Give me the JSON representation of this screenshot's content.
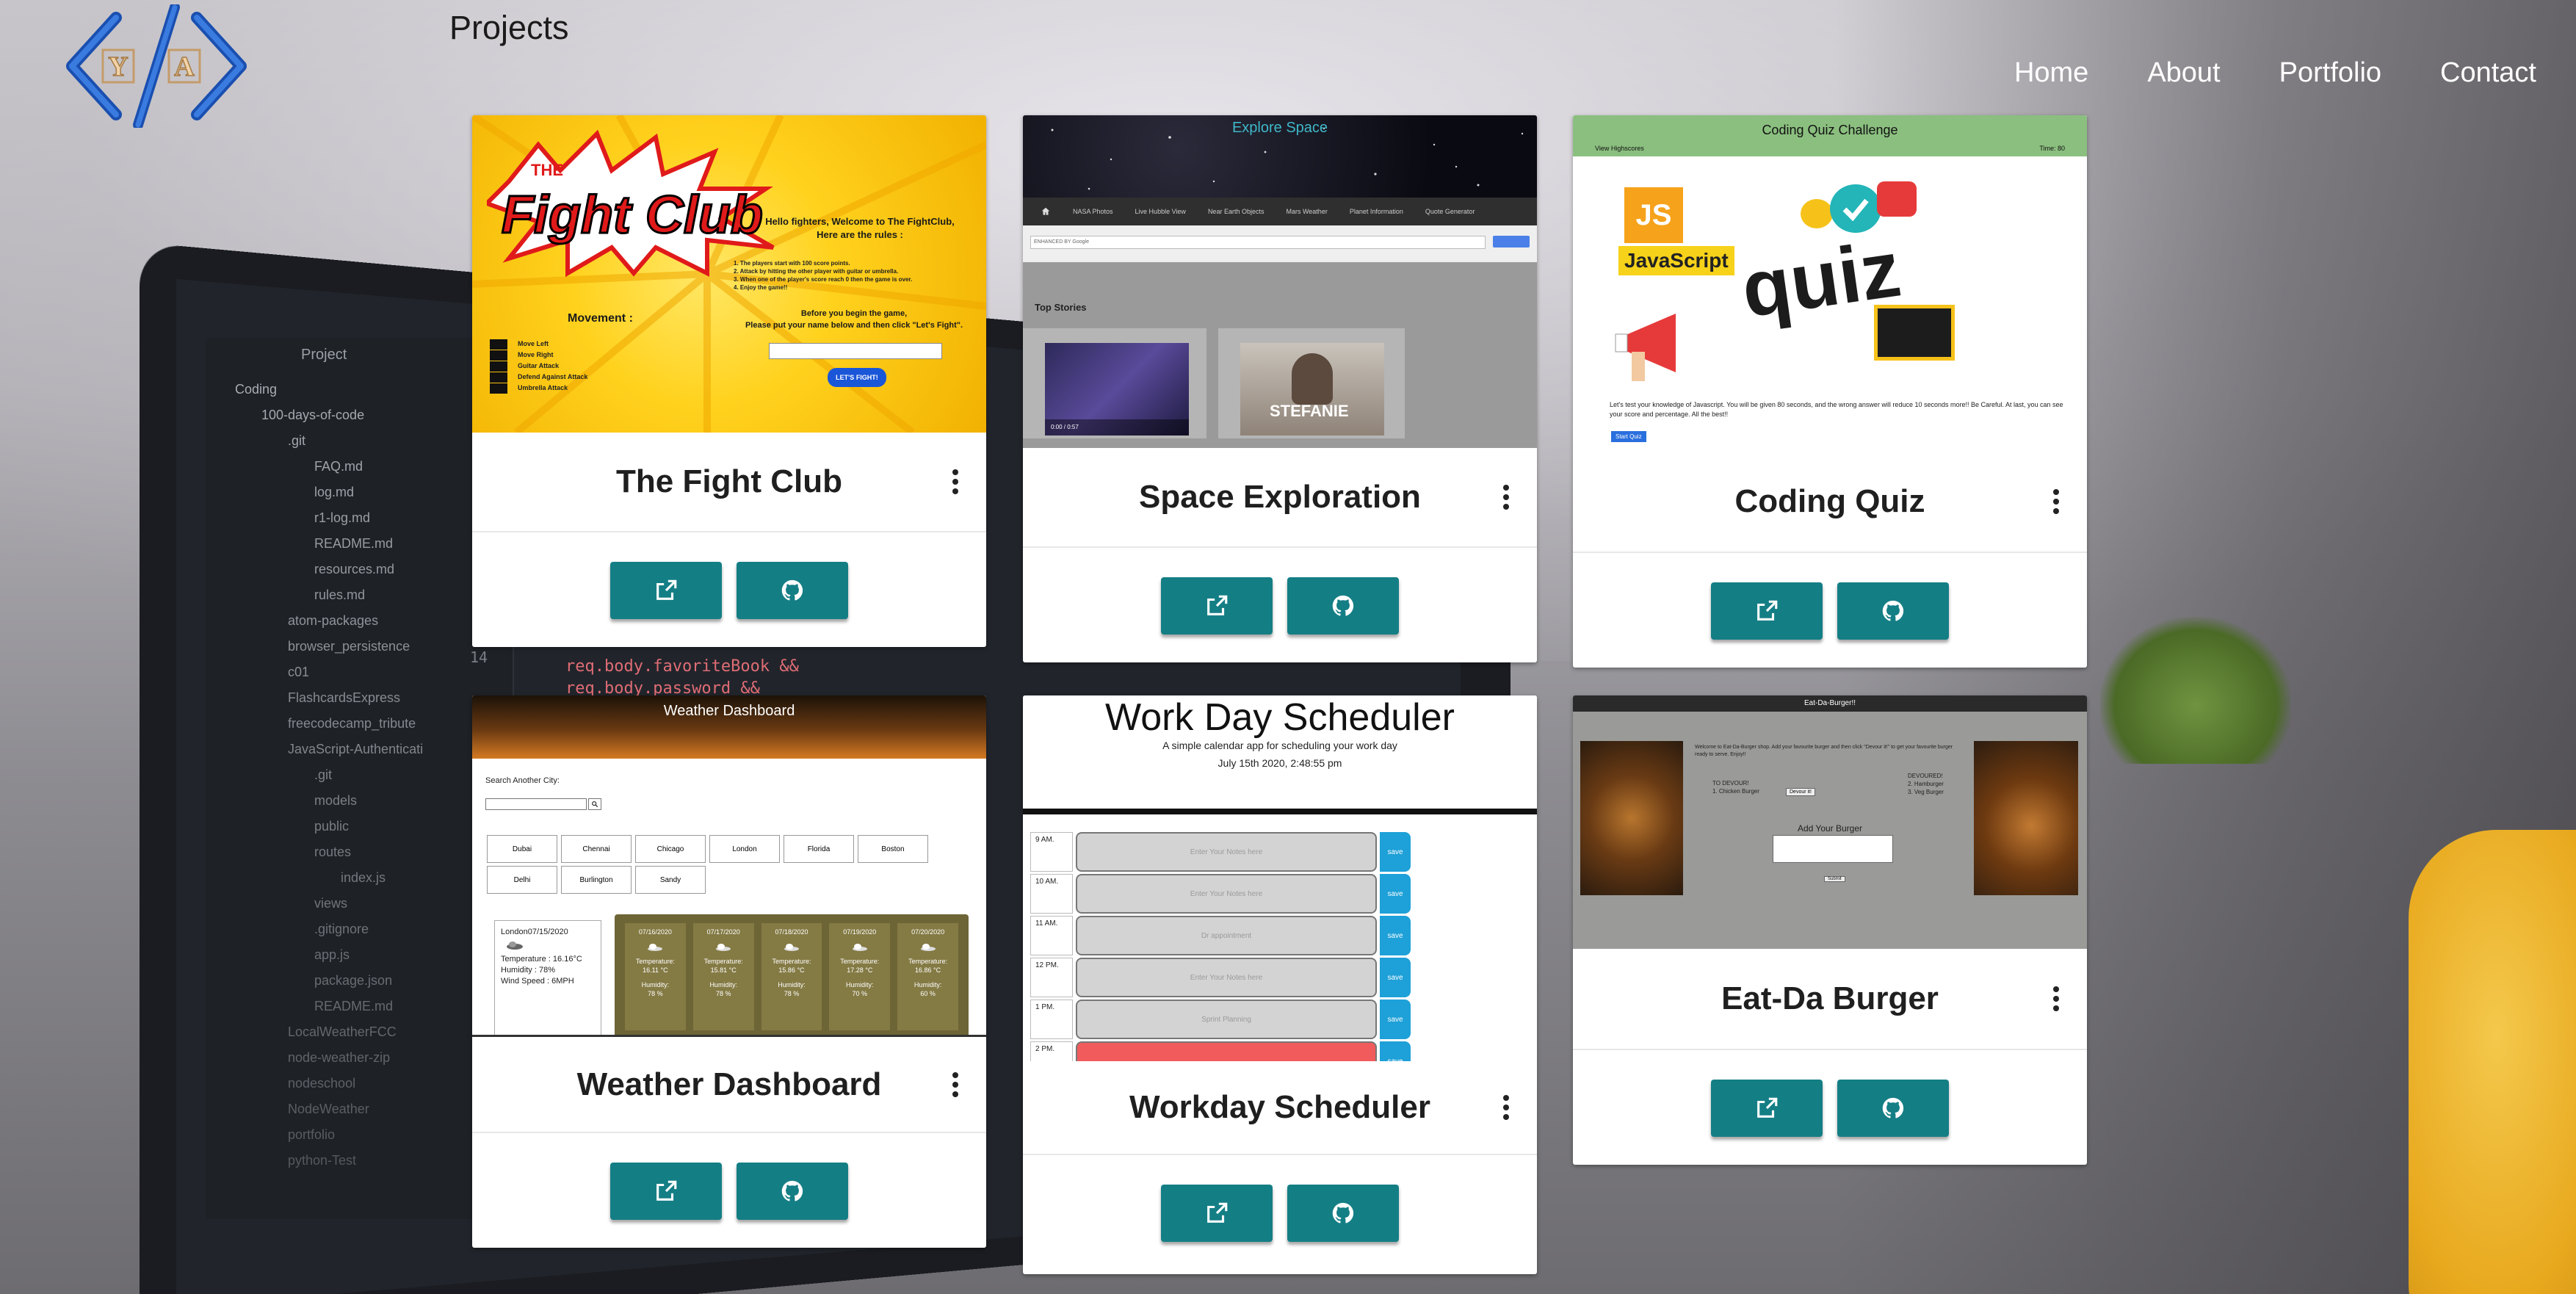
{
  "header": {
    "logo_letters": [
      "Y",
      "A"
    ],
    "page_title": "Projects"
  },
  "nav": [
    {
      "label": "Home"
    },
    {
      "label": "About"
    },
    {
      "label": "Portfolio"
    },
    {
      "label": "Contact"
    }
  ],
  "projects": [
    {
      "title": "The Fight Club",
      "preview": {
        "logo_small": "THE",
        "logo_big": "Fight Club",
        "welcome": "Hello fighters, Welcome to The FightClub,",
        "rules_heading": "Here are the rules :",
        "rules": [
          "1. The players start with 100 score points.",
          "2. Attack by hitting the other player with guitar or umbrella.",
          "3. When one of the player's score reach 0 then the game is over.",
          "4. Enjoy the game!!"
        ],
        "movement_heading": "Movement :",
        "movements": [
          "Move Left",
          "Move Right",
          "Guitar Attack",
          "Defend Against Attack",
          "Umbrella Attack"
        ],
        "prompt": "Before you begin the game,",
        "prompt2": "Please put your name below and then click \"Let's Fight\".",
        "button": "LET'S FIGHT!"
      }
    },
    {
      "title": "Space Exploration",
      "preview": {
        "heading": "Explore Space",
        "tabs": [
          "NASA Photos",
          "Live Hubble View",
          "Near Earth Objects",
          "Mars Weather",
          "Planet Information",
          "Quote Generator"
        ],
        "search_label": "ENHANCED BY Google",
        "stories_heading": "Top Stories",
        "video_time": "0:00 / 0:57",
        "video2_name": "STEFANIE"
      }
    },
    {
      "title": "Coding Quiz",
      "preview": {
        "heading": "Coding Quiz Challenge",
        "highscores": "View Highscores",
        "time": "Time: 80",
        "js_badge": "JS",
        "js_label": "JavaScript",
        "quiz_word": "quiz",
        "description": "Let's test your knowledge of Javascript. You will be given 80 seconds, and the wrong answer will reduce 10 seconds more!! Be Careful. At last, you can see your score and percentage. All the best!!",
        "start": "Start Quiz"
      }
    },
    {
      "title": "Weather Dashboard",
      "preview": {
        "heading": "Weather Dashboard",
        "search_label": "Search Another City:",
        "cities_row1": [
          "Dubai",
          "Chennai",
          "Chicago",
          "London",
          "Florida",
          "Boston"
        ],
        "cities_row2": [
          "Delhi",
          "Burlington",
          "Sandy"
        ],
        "today_city": "London07/15/2020",
        "today_temp": "Temperature : 16.16°C",
        "today_humidity": "Humidity : 78%",
        "today_wind": "Wind Speed : 6MPH",
        "forecast": [
          {
            "date": "07/16/2020",
            "temp": "16.11 °C",
            "hum": "78 %"
          },
          {
            "date": "07/17/2020",
            "temp": "15.81 °C",
            "hum": "78 %"
          },
          {
            "date": "07/18/2020",
            "temp": "15.86 °C",
            "hum": "78 %"
          },
          {
            "date": "07/19/2020",
            "temp": "17.28 °C",
            "hum": "70 %"
          },
          {
            "date": "07/20/2020",
            "temp": "16.86 °C",
            "hum": "60 %"
          }
        ],
        "temp_label": "Temperature:",
        "hum_label": "Humidity:"
      }
    },
    {
      "title": "Workday Scheduler",
      "preview": {
        "heading": "Work Day Scheduler",
        "subheading": "A simple calendar app for scheduling your work day",
        "date": "July 15th 2020, 2:48:55 pm",
        "rows": [
          {
            "hour": "9 AM.",
            "text": "Enter Your Notes here",
            "state": "past"
          },
          {
            "hour": "10 AM.",
            "text": "Enter Your Notes here",
            "state": "past"
          },
          {
            "hour": "11 AM.",
            "text": "Dr appointment",
            "state": "past"
          },
          {
            "hour": "12 PM.",
            "text": "Enter Your Notes here",
            "state": "past"
          },
          {
            "hour": "1 PM.",
            "text": "Sprint Planning",
            "state": "past"
          },
          {
            "hour": "2 PM.",
            "text": "",
            "state": "present"
          }
        ],
        "save": "save"
      }
    },
    {
      "title": "Eat-Da Burger",
      "preview": {
        "heading": "Eat-Da-Burger!!",
        "intro": "Welcome to Eat-Da-Burger shop. Add your favourite burger and then click \"Devour it!\" to get your favourite burger ready to serve. Enjoy!!",
        "to_devour_label": "TO DEVOUR!",
        "to_devour_item": "1. Chicken Burger",
        "devour_btn": "Devour it!",
        "devoured_label": "DEVOURED!",
        "devoured_items": [
          "2. Hamburger",
          "3. Veg Burger"
        ],
        "add_label": "Add Your Burger",
        "submit": "Submit"
      }
    }
  ],
  "colors": {
    "button": "#147e85",
    "quiz_header": "#8bbf7f",
    "weather_forecast": "#6e6536",
    "scheduler_past": "#d3d3d3",
    "scheduler_present": "#f25b5b",
    "scheduler_save": "#1ea0d8"
  },
  "icons": [
    "external-link-icon",
    "github-icon",
    "more-vertical-icon"
  ],
  "background_text": {
    "tree_title": "Project",
    "tree": [
      "Coding",
      "100-days-of-code",
      ".git",
      "FAQ.md",
      "log.md",
      "r1-log.md",
      "README.md",
      "resources.md",
      "rules.md",
      "atom-packages",
      "browser_persistence",
      "c01",
      "FlashcardsExpress",
      "freecodecamp_tribute",
      "JavaScript-Authenticati",
      ".git",
      "models",
      "public",
      "routes",
      "index.js",
      "views",
      ".gitignore",
      "app.js",
      "package.json",
      "README.md",
      "LocalWeatherFCC",
      "node-weather-zip",
      "nodeschool",
      "NodeWeather",
      "portfolio",
      "python-Test"
    ],
    "code": [
      "req.body.favoriteBook &&",
      "req.body.password &&"
    ],
    "line_number": "14"
  }
}
